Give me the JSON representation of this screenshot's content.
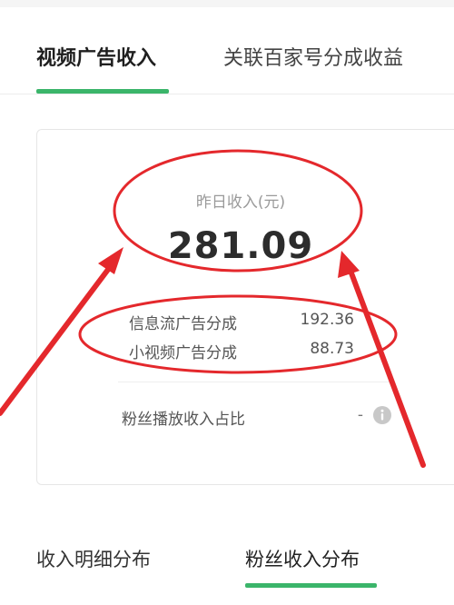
{
  "tabs_top": [
    {
      "label": "视频广告收入",
      "active": true
    },
    {
      "label": "关联百家号分成收益",
      "active": false
    }
  ],
  "card": {
    "yesterday_label": "昨日收入(元)",
    "yesterday_value": "281.09",
    "rows": [
      {
        "label": "信息流广告分成",
        "value": "192.36"
      },
      {
        "label": "小视频广告分成",
        "value": "88.73"
      }
    ],
    "fan_ratio": {
      "label": "粉丝播放收入占比",
      "value": "-"
    }
  },
  "tabs_bottom": [
    {
      "label": "收入明细分布",
      "active": false
    },
    {
      "label": "粉丝收入分布",
      "active": true
    }
  ],
  "colors": {
    "accent_green": "#3bb56a",
    "annotation_red": "#e4282c"
  },
  "icons": {
    "info": "info-icon"
  }
}
